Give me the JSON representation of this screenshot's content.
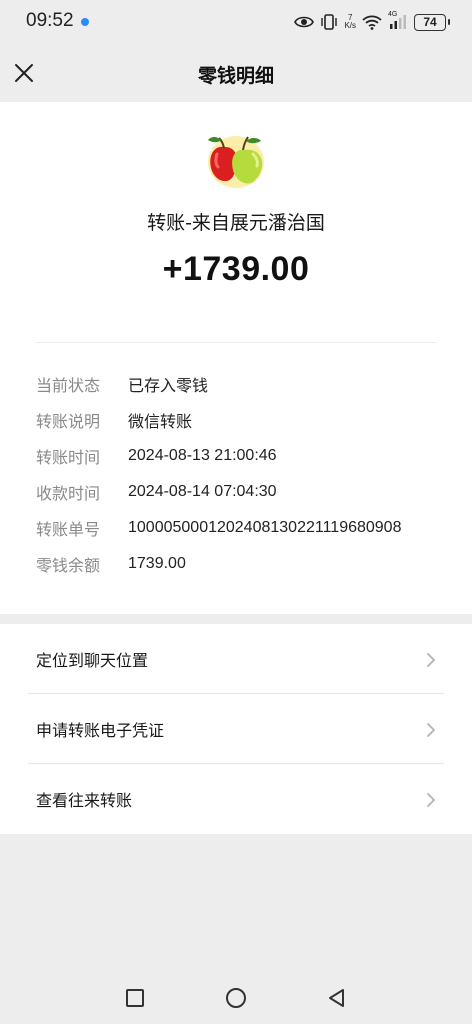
{
  "status": {
    "time": "09:52",
    "net_speed_value": "7",
    "net_speed_unit": "K/s",
    "signal_label": "4G",
    "battery": "74",
    "accent_dot_color": "#2a8cf7"
  },
  "nav": {
    "title": "零钱明细",
    "close_icon": "close-icon"
  },
  "transfer": {
    "title": "转账-来自展元潘治国",
    "amount": "+1739.00"
  },
  "details": [
    {
      "label": "当前状态",
      "value": "已存入零钱"
    },
    {
      "label": "转账说明",
      "value": "微信转账"
    },
    {
      "label": "转账时间",
      "value": "2024-08-13 21:00:46"
    },
    {
      "label": "收款时间",
      "value": "2024-08-14 07:04:30"
    },
    {
      "label": "转账单号",
      "value": "1000050001202408130221119680908"
    },
    {
      "label": "零钱余额",
      "value": "1739.00"
    }
  ],
  "menu": [
    {
      "label": "定位到聊天位置"
    },
    {
      "label": "申请转账电子凭证"
    },
    {
      "label": "查看往来转账"
    }
  ],
  "system_nav": [
    "square-icon",
    "circle-icon",
    "triangle-back-icon"
  ]
}
